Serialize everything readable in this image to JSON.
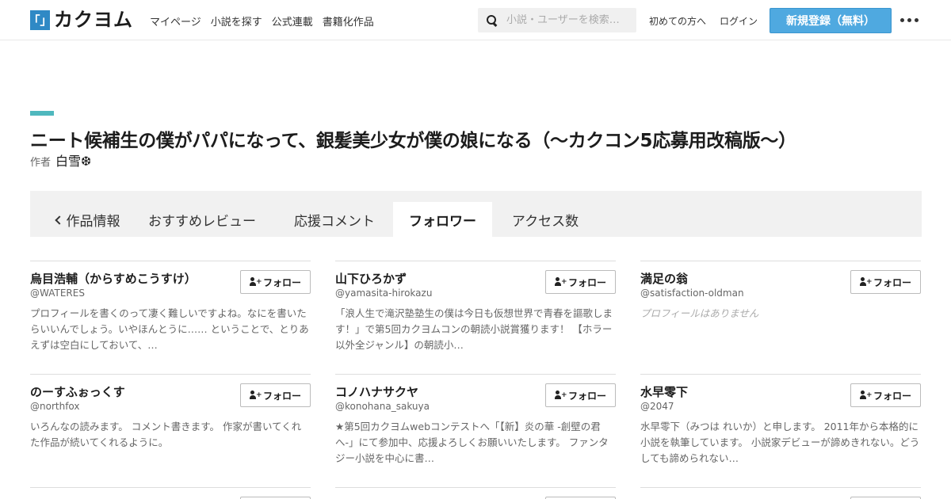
{
  "header": {
    "logo_mark": "「」",
    "logo_text": "カクヨム",
    "nav": [
      "マイページ",
      "小説を探す",
      "公式連載",
      "書籍化作品"
    ],
    "search_placeholder": "小説・ユーザーを検索…",
    "first_time_link": "初めての方へ",
    "login_link": "ログイン",
    "signup_button": "新規登録（無料）"
  },
  "work": {
    "title": "ニート候補生の僕がパパになって、銀髪美少女が僕の娘になる（～カクコン5応募用改稿版～）",
    "author_label": "作者",
    "author_name": "白雪❆"
  },
  "tabs": [
    "作品情報",
    "おすすめレビュー",
    "応援コメント",
    "フォロワー",
    "アクセス数"
  ],
  "active_tab": "フォロワー",
  "follow_label": "フォロー",
  "followers": [
    {
      "name": "烏目浩輔（からすめこうすけ）",
      "handle": "@WATERES",
      "bio": "プロフィールを書くのって凄く難しいですよね。なにを書いたらいいんでしょう。いやほんとうに…… ということで、とりあえずは空白にしておいて、…"
    },
    {
      "name": "山下ひろかず",
      "handle": "@yamasita-hirokazu",
      "bio": "「浪人生で滝沢塾塾生の僕は今日も仮想世界で青春を謳歌します！」で第5回カクヨムコンの朝読小説賞獲ります！ 【ホラー以外全ジャンル】の朝読小…"
    },
    {
      "name": "満足の翁",
      "handle": "@satisfaction-oldman",
      "bio": "プロフィールはありません",
      "bio_empty": true
    },
    {
      "name": "のーすふぉっくす",
      "handle": "@northfox",
      "bio": "いろんなの読みます。 コメント書きます。 作家が書いてくれた作品が続いてくれるように。"
    },
    {
      "name": "コノハナサクヤ",
      "handle": "@konohana_sakuya",
      "bio": "★第5回カクヨムwebコンテストへ「【新】炎の華 -創壁の君へ-」にて参加中、応援よろしくお願いいたします。 ファンタジー小説を中心に書…"
    },
    {
      "name": "水早零下",
      "handle": "@2047",
      "bio": "水早零下（みつは れいか）と申します。 2011年から本格的に小説を執筆しています。 小説家デビューが諦めきれない。どうしても諦められない…"
    }
  ]
}
